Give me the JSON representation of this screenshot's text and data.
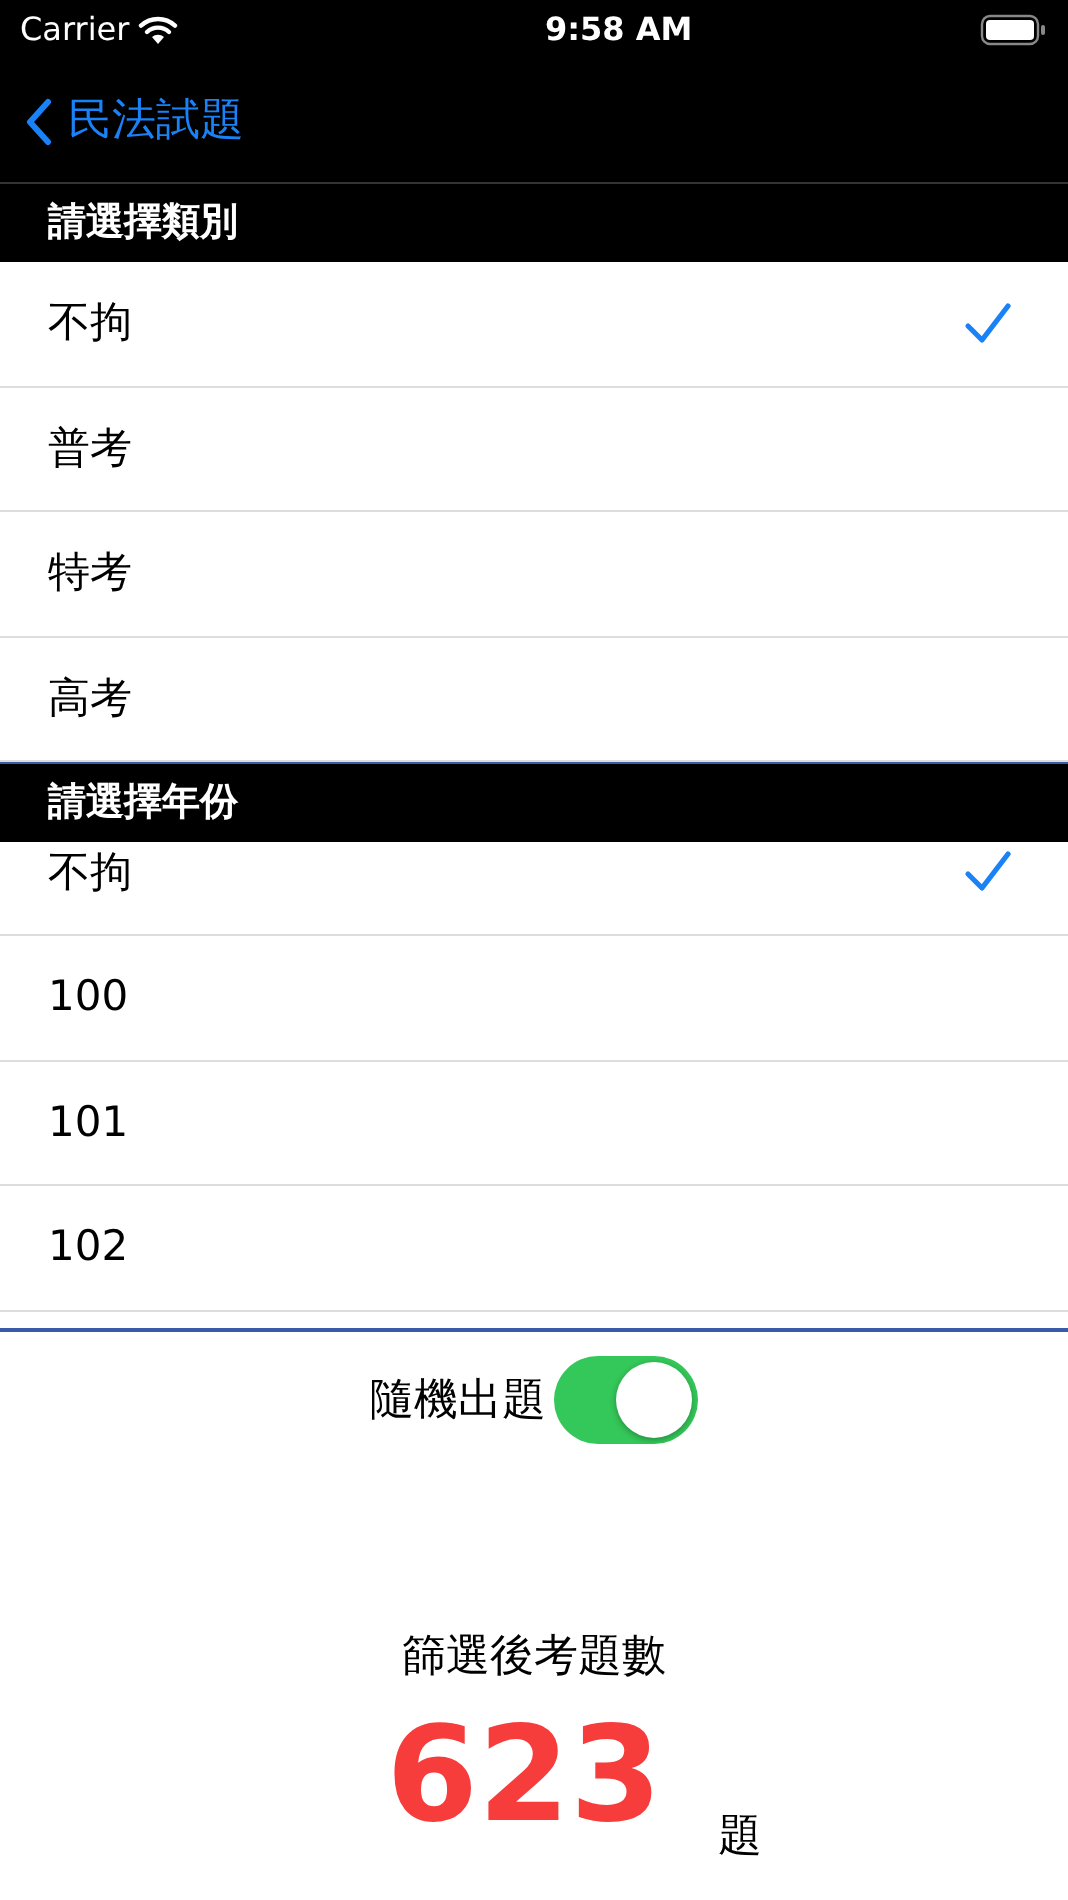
{
  "status_bar": {
    "carrier": "Carrier",
    "time": "9:58 AM"
  },
  "nav": {
    "back_title": "民法試題"
  },
  "sections": [
    {
      "header": "請選擇類別",
      "items": [
        {
          "label": "不拘",
          "selected": true
        },
        {
          "label": "普考",
          "selected": false
        },
        {
          "label": "特考",
          "selected": false
        },
        {
          "label": "高考",
          "selected": false
        }
      ]
    },
    {
      "header": "請選擇年份",
      "items": [
        {
          "label": "不拘",
          "selected": true
        },
        {
          "label": "100",
          "selected": false
        },
        {
          "label": "101",
          "selected": false
        },
        {
          "label": "102",
          "selected": false
        }
      ]
    }
  ],
  "random": {
    "label": "隨機出題",
    "on": true
  },
  "result": {
    "caption": "篩選後考題數",
    "count": "623",
    "unit": "題"
  }
}
